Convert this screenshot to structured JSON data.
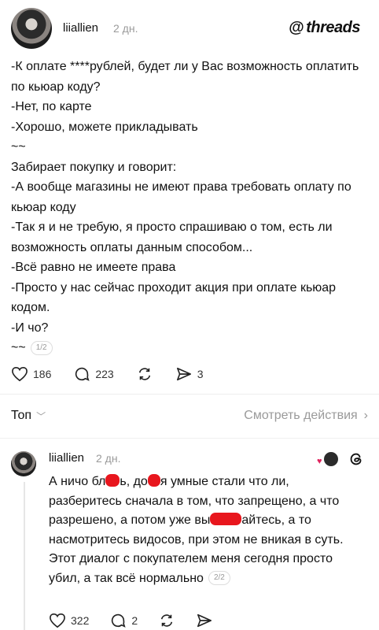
{
  "post": {
    "author": "liiallien",
    "time": "2 дн.",
    "brand": "threads",
    "lines": [
      "-К оплате ****рублей, будет ли у Вас возможность оплатить по кьюар коду?",
      "-Нет, по карте",
      "-Хорошо, можете прикладывать",
      "~~",
      "Забирает покупку и говорит:",
      "-А вообще магазины не имеют права требовать оплату по кьюар коду",
      "-Так я и не требую, я просто спрашиваю о том, есть ли возможность оплаты данным способом...",
      "-Всё равно не имеете права",
      "-Просто у нас сейчас проходит акция при оплате кьюар кодом.",
      "-И чо?"
    ],
    "last_line": "~~",
    "pager": "1/2",
    "likes": "186",
    "comments": "223",
    "shares": "3"
  },
  "sort": {
    "label": "Топ",
    "view_activity": "Смотреть действия"
  },
  "reply": {
    "author": "liiallien",
    "time": "2 дн.",
    "seg_a": "А ничо бл",
    "seg_b": "ь, до",
    "seg_c": "я умные стали что ли,",
    "seg_d": "разберитесь сначала в том, что запрещено, а что разрешено, а потом уже вы",
    "seg_e": "айтесь, а то насмотритесь видосов, при этом не вникая в суть.",
    "line2": "Этот диалог с покупателем меня сегодня просто убил, а так всё нормально",
    "pager": "2/2",
    "likes": "322",
    "comments": "2"
  },
  "colors": {
    "redaction": "#e8161d",
    "muted": "#9a9a9a"
  }
}
